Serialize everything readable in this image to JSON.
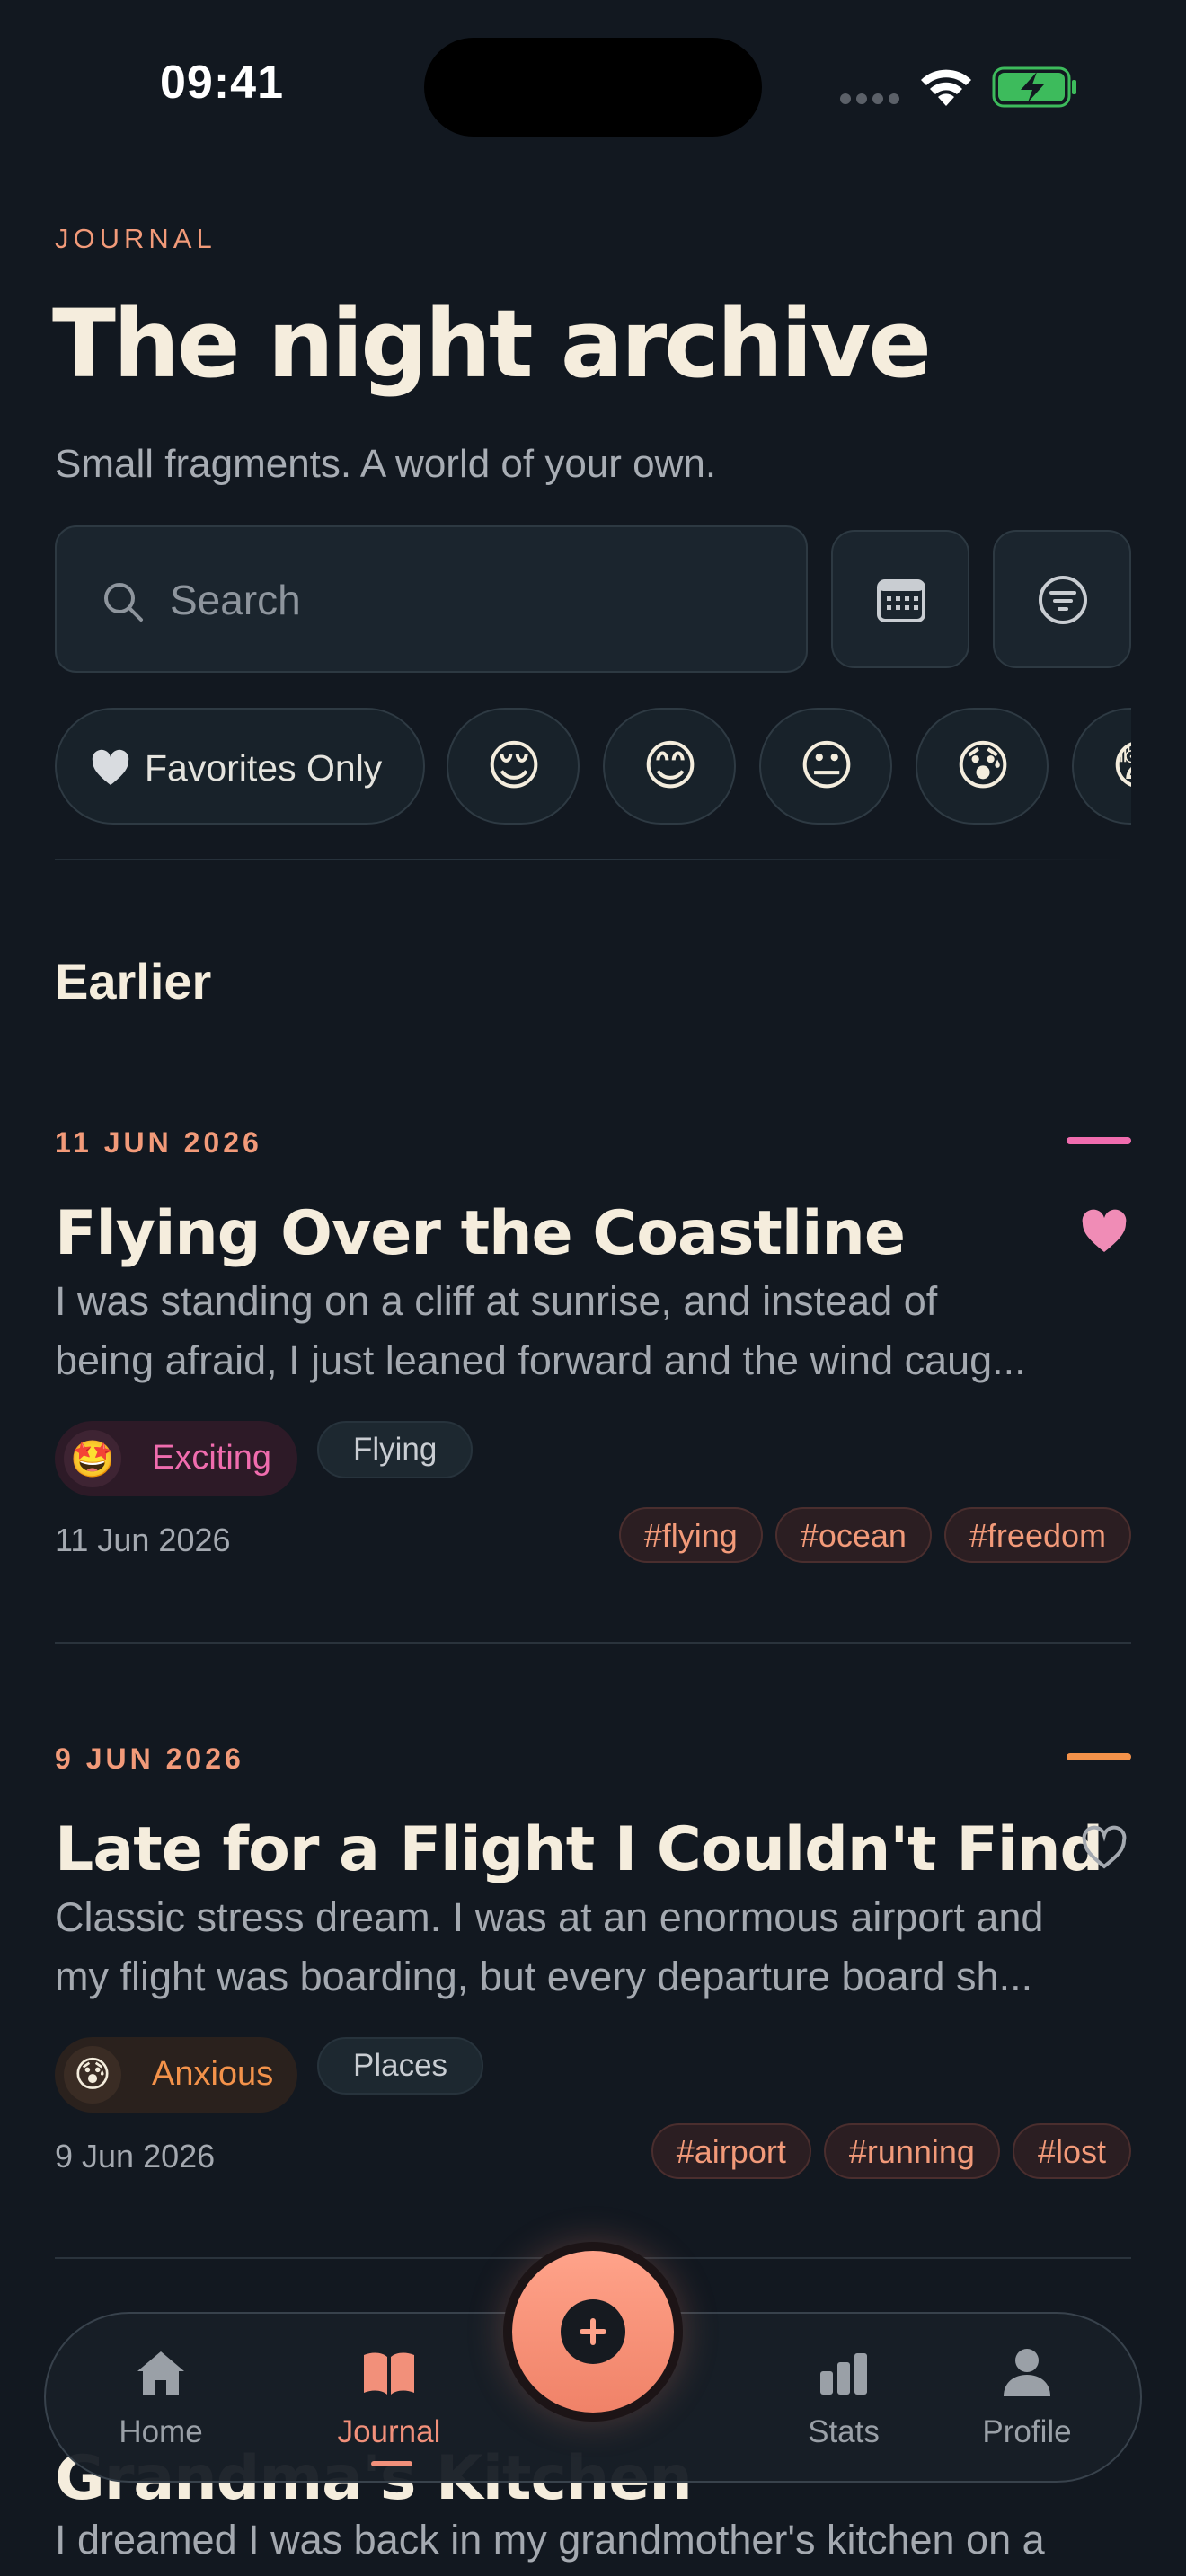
{
  "status": {
    "time": "09:41"
  },
  "header": {
    "eyebrow": "JOURNAL",
    "title": "The night archive",
    "subtitle": "Small fragments. A world of your own."
  },
  "search": {
    "placeholder": "Search"
  },
  "filters": {
    "favorites_label": "Favorites Only",
    "moods": [
      "😌",
      "😊",
      "😐",
      "😰",
      "😨"
    ]
  },
  "section": {
    "title": "Earlier"
  },
  "entries": [
    {
      "date_header": "11 JUN 2026",
      "title": "Flying Over the Coastline",
      "excerpt_line1": "I was standing on a cliff at sunrise, and instead of",
      "excerpt_line2": "being afraid, I just leaned forward and the wind caug...",
      "mood_emoji": "🤩",
      "mood": "Exciting",
      "category": "Flying",
      "date": "11 Jun 2026",
      "tags": [
        "#flying",
        "#ocean",
        "#freedom"
      ],
      "favorite": true,
      "accent_color": "#F06CAE"
    },
    {
      "date_header": "9 JUN 2026",
      "title": "Late for a Flight I Couldn't Find",
      "excerpt_line1": "Classic stress dream. I was at an enormous airport and",
      "excerpt_line2": "my flight was boarding, but every departure board sh...",
      "mood_emoji": "😰",
      "mood": "Anxious",
      "category": "Places",
      "date": "9 Jun 2026",
      "tags": [
        "#airport",
        "#running",
        "#lost"
      ],
      "favorite": false,
      "accent_color": "#F3924A"
    },
    {
      "title": "Grandma's Kitchen",
      "excerpt": "I dreamed I was back in my grandmother's kitchen on a"
    }
  ],
  "tabbar": {
    "home": "Home",
    "journal": "Journal",
    "stats": "Stats",
    "profile": "Profile"
  },
  "colors": {
    "background": "#121820",
    "accent": "#F29A79",
    "exciting": "#F06CAE",
    "anxious": "#F3924A"
  }
}
